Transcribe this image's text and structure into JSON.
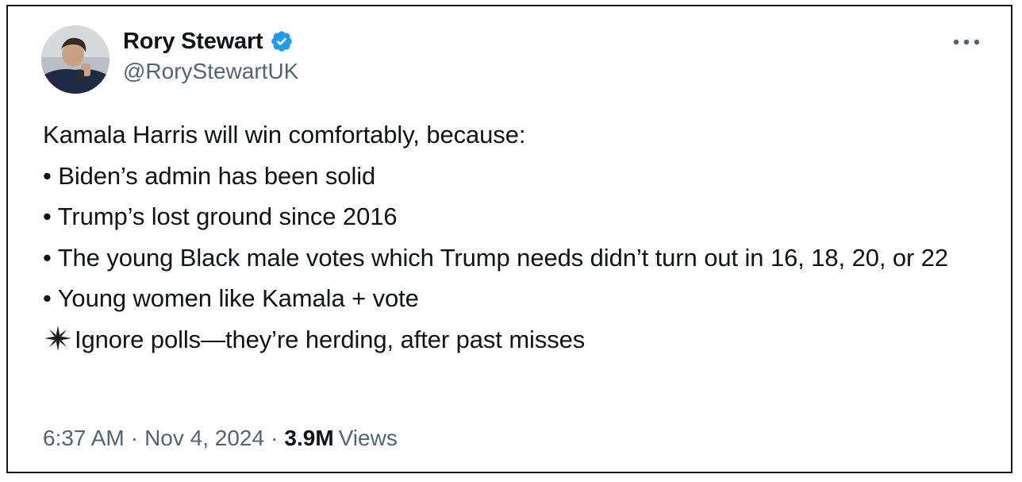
{
  "author": {
    "display_name": "Rory Stewart",
    "handle": "@RoryStewartUK",
    "verified": true,
    "verified_color": "#1d9bf0"
  },
  "icons": {
    "more": "more-horizontal-icon",
    "verified": "verified-badge-icon",
    "sparkle": "sparkle-icon"
  },
  "tweet": {
    "lines": [
      "Kamala Harris will win comfortably, because:",
      "• Biden’s admin has been solid",
      "• Trump’s lost ground since 2016",
      "• The young Black male votes which Trump needs didn’t turn out in 16, 18, 20, or 22",
      "• Young women like Kamala + vote",
      "Ignore polls—they’re herding, after past misses"
    ]
  },
  "meta": {
    "time": "6:37 AM",
    "date": "Nov 4, 2024",
    "separator": "·",
    "views_count": "3.9M",
    "views_label": "Views"
  },
  "colors": {
    "text": "#0f1419",
    "secondary": "#536471",
    "frame": "#1a1a1a"
  }
}
